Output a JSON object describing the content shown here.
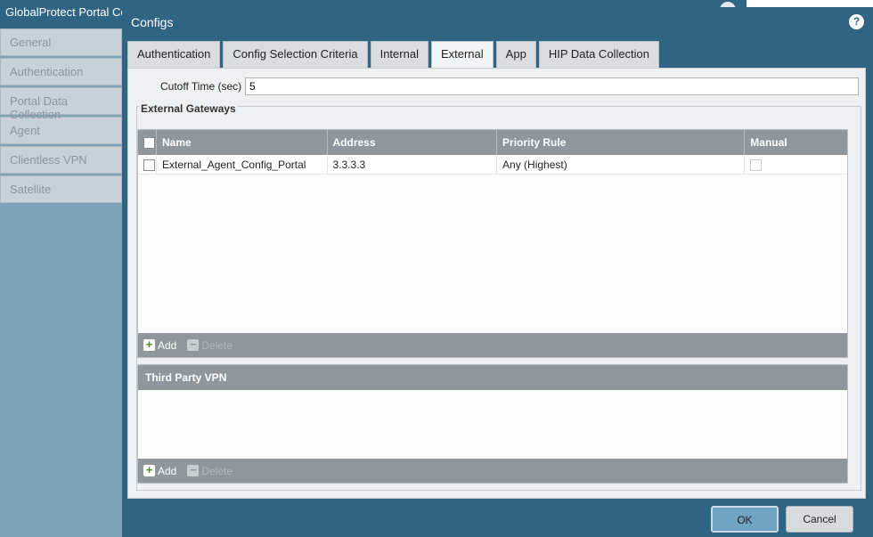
{
  "background": {
    "title": "GlobalProtect Portal Co",
    "sidebar": [
      "General",
      "Authentication",
      "Portal Data Collection",
      "Agent",
      "Clientless VPN",
      "Satellite"
    ]
  },
  "dialog": {
    "title": "Configs",
    "help_icon": "?",
    "tabs": [
      {
        "label": "Authentication",
        "active": false
      },
      {
        "label": "Config Selection Criteria",
        "active": false
      },
      {
        "label": "Internal",
        "active": false
      },
      {
        "label": "External",
        "active": true
      },
      {
        "label": "App",
        "active": false
      },
      {
        "label": "HIP Data Collection",
        "active": false
      }
    ],
    "cutoff": {
      "label": "Cutoff Time (sec)",
      "value": "5"
    },
    "external_gateways": {
      "legend": "External Gateways",
      "columns": [
        "Name",
        "Address",
        "Priority Rule",
        "Manual"
      ],
      "rows": [
        {
          "name": "External_Agent_Config_Portal",
          "address": "3.3.3.3",
          "priority": "Any (Highest)",
          "manual": false
        }
      ],
      "add_label": "Add",
      "delete_label": "Delete"
    },
    "third_party_vpn": {
      "header": "Third Party VPN",
      "add_label": "Add",
      "delete_label": "Delete"
    },
    "ok_label": "OK",
    "cancel_label": "Cancel"
  },
  "colors": {
    "dialog_bg": "#2f6483",
    "grid_header": "#8f979c",
    "ok_button": "#6ea3c1"
  }
}
